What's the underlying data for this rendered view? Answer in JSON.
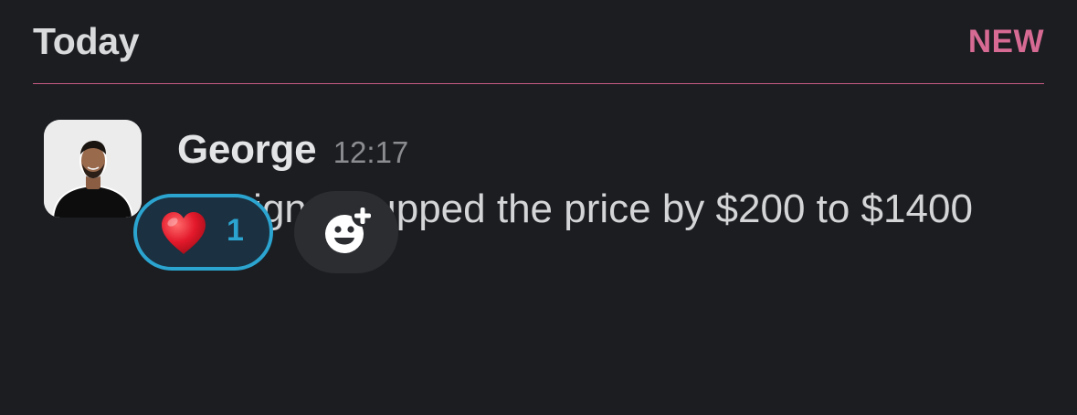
{
  "day_divider": {
    "label": "Today",
    "badge": "NEW"
  },
  "message": {
    "author": "George",
    "time": "12:17",
    "text": "#3 signed, upped the price by $200 to $1400",
    "avatar_icon": "person-photo-avatar",
    "reactions": [
      {
        "emoji": "❤️",
        "icon": "red-heart-emoji",
        "count": "1",
        "selected": true
      }
    ],
    "add_reaction_icon": "add-emoji-icon"
  },
  "colors": {
    "background": "#1b1d21",
    "new_accent": "#d66a93",
    "reaction_accent": "#2ba4d0"
  }
}
